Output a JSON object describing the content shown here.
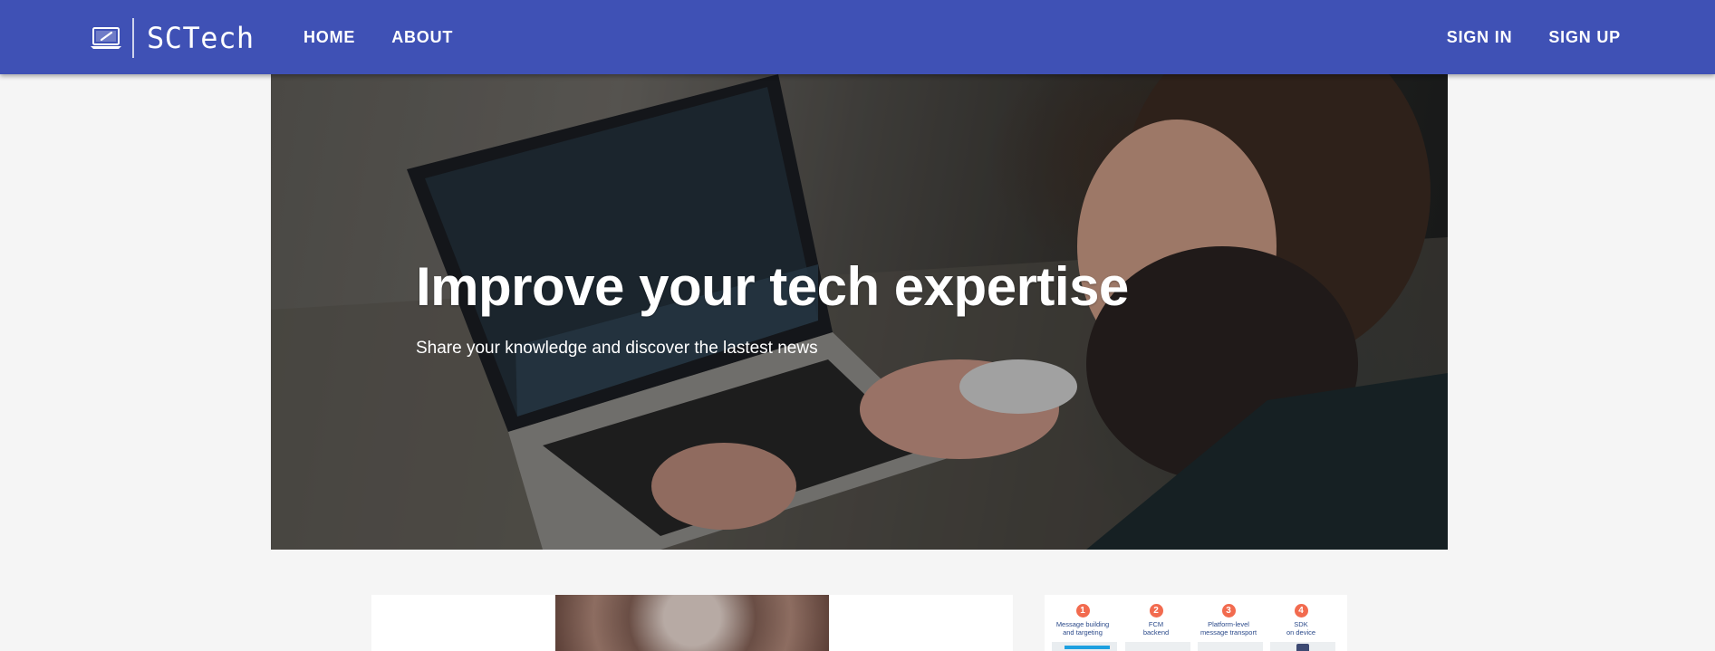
{
  "brand": {
    "name": "SCTech",
    "logo_icon": "laptop-pen-icon"
  },
  "nav": {
    "left": [
      "HOME",
      "ABOUT"
    ],
    "right": [
      "SIGN IN",
      "SIGN UP"
    ]
  },
  "hero": {
    "title": "Improve your tech expertise",
    "subtitle": "Share your knowledge and discover the lastest news"
  },
  "diagram": {
    "steps": [
      {
        "num": "1",
        "label": "Message building\nand targeting"
      },
      {
        "num": "2",
        "label": "FCM\nbackend"
      },
      {
        "num": "3",
        "label": "Platform-level\nmessage transport"
      },
      {
        "num": "4",
        "label": "SDK\non device"
      }
    ]
  },
  "colors": {
    "appbar": "#3f51b5",
    "accent": "#f26b4f"
  }
}
